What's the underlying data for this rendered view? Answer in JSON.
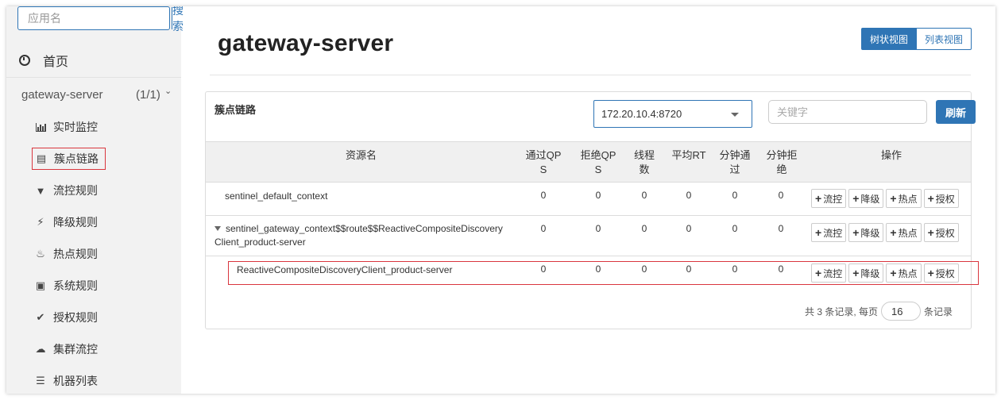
{
  "sidebar": {
    "search": {
      "placeholder": "应用名",
      "button_label": "搜索"
    },
    "home_label": "首页",
    "app": {
      "name": "gateway-server",
      "count": "(1/1)"
    },
    "menu": [
      {
        "label": "实时监控",
        "icon": "bar-chart-icon"
      },
      {
        "label": "簇点链路",
        "icon": "list-icon",
        "active": true
      },
      {
        "label": "流控规则",
        "icon": "filter-icon"
      },
      {
        "label": "降级规则",
        "icon": "flash-icon"
      },
      {
        "label": "热点规则",
        "icon": "fire-icon"
      },
      {
        "label": "系统规则",
        "icon": "lock-icon"
      },
      {
        "label": "授权规则",
        "icon": "check-icon"
      },
      {
        "label": "集群流控",
        "icon": "cloud-icon"
      },
      {
        "label": "机器列表",
        "icon": "list-grid-icon"
      }
    ]
  },
  "main": {
    "title": "gateway-server",
    "view_toggle": {
      "tree": "树状视图",
      "list": "列表视图"
    },
    "panel": {
      "title": "簇点链路",
      "machine": "172.20.10.4:8720",
      "keyword_placeholder": "关键字",
      "refresh_label": "刷新"
    },
    "table": {
      "headers": {
        "resource": "资源名",
        "pass_qps": "通过QP\nS",
        "block_qps": "拒绝QP\nS",
        "threads": "线程\n数",
        "avg_rt": "平均RT",
        "minute_pass": "分钟通\n过",
        "minute_block": "分钟拒\n绝",
        "actions": "操作"
      },
      "rows": [
        {
          "name": "sentinel_default_context",
          "values": [
            "0",
            "0",
            "0",
            "0",
            "0",
            "0"
          ],
          "expanded": false
        },
        {
          "name": "sentinel_gateway_context$$route$$ReactiveCompositeDiscovery\nClient_product-server",
          "values": [
            "0",
            "0",
            "0",
            "0",
            "0",
            "0"
          ],
          "expanded": true
        },
        {
          "name": "ReactiveCompositeDiscoveryClient_product-server",
          "values": [
            "0",
            "0",
            "0",
            "0",
            "0",
            "0"
          ],
          "expanded": false
        }
      ],
      "actions": [
        "流控",
        "降级",
        "热点",
        "授权"
      ]
    },
    "pager": {
      "prefix": "共 3 条记录, 每页",
      "page_size": "16",
      "suffix": "条记录"
    }
  },
  "colors": {
    "primary": "#2f75b5",
    "highlight": "#d9363e"
  }
}
